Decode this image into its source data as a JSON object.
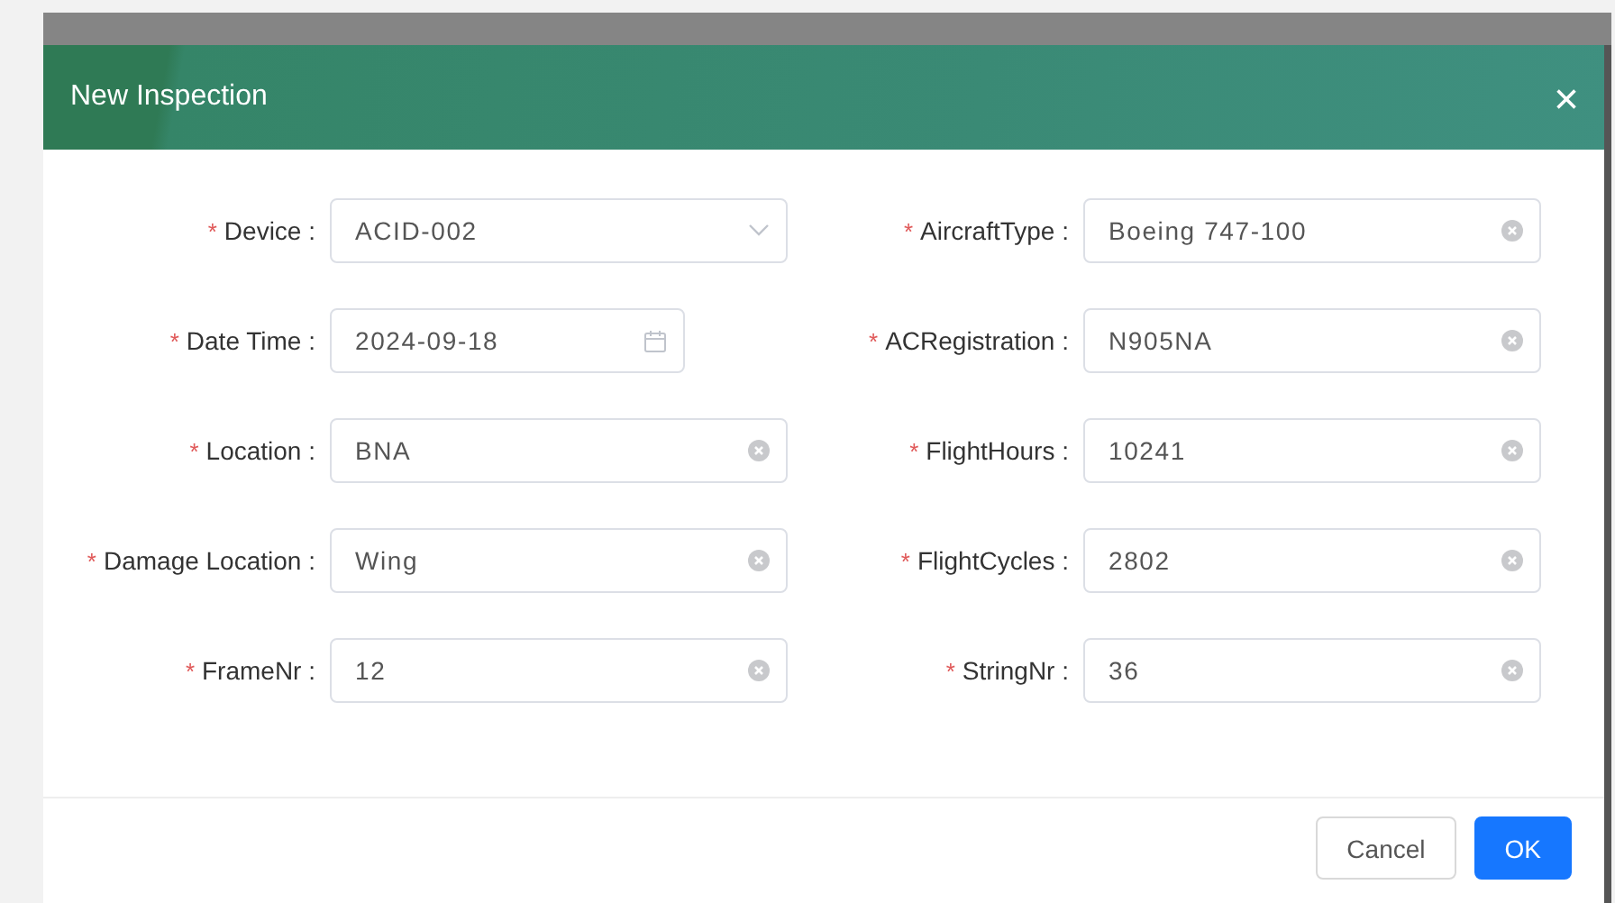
{
  "dialog": {
    "title": "New Inspection",
    "close": "×"
  },
  "fields": [
    {
      "label": "Device :",
      "required_mark": "*",
      "kind": "select",
      "value": "ACID-002"
    },
    {
      "label": "AircraftType :",
      "required_mark": "*",
      "kind": "text",
      "value": "Boeing 747-100"
    },
    {
      "label": "Date Time :",
      "required_mark": "*",
      "kind": "date",
      "value": "2024-09-18"
    },
    {
      "label": "ACRegistration :",
      "required_mark": "*",
      "kind": "text",
      "value": "N905NA"
    },
    {
      "label": "Location :",
      "required_mark": "*",
      "kind": "text",
      "value": "BNA"
    },
    {
      "label": "FlightHours :",
      "required_mark": "*",
      "kind": "text",
      "value": "10241"
    },
    {
      "label": "Damage Location :",
      "required_mark": "*",
      "kind": "text",
      "value": "Wing"
    },
    {
      "label": "FlightCycles :",
      "required_mark": "*",
      "kind": "text",
      "value": "2802"
    },
    {
      "label": "FrameNr :",
      "required_mark": "*",
      "kind": "text",
      "value": "12"
    },
    {
      "label": "StringNr :",
      "required_mark": "*",
      "kind": "text",
      "value": "36"
    }
  ],
  "buttons": [
    {
      "label": "Cancel",
      "kind": "default"
    },
    {
      "label": "OK",
      "kind": "primary"
    }
  ]
}
